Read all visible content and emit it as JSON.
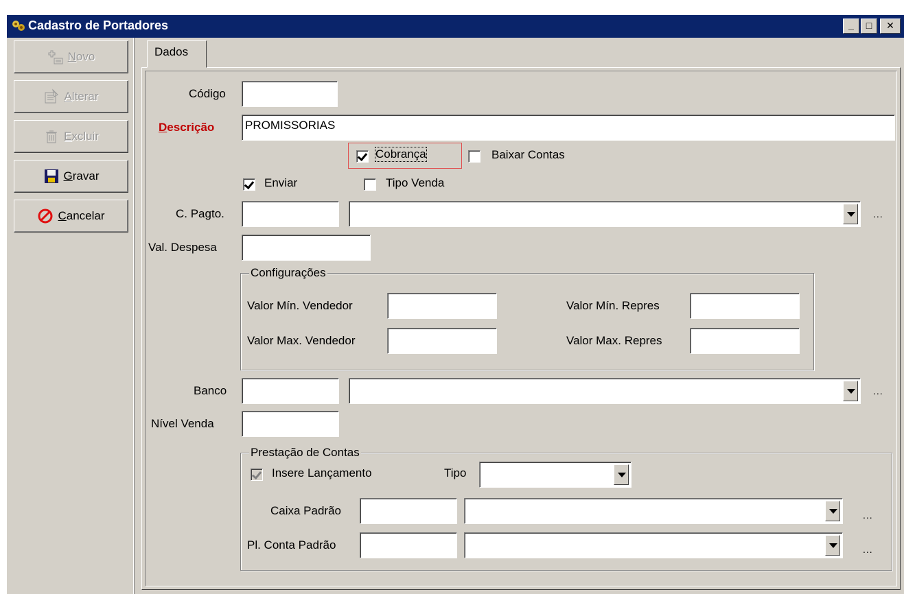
{
  "window": {
    "title": "Cadastro de Portadores",
    "controls": {
      "minimize": "_",
      "maximize": "□",
      "close": "✕"
    },
    "titlebar_color": "#0a246a"
  },
  "toolbar": {
    "novo": {
      "prefix": "",
      "hotkey": "N",
      "rest": "ovo",
      "enabled": false,
      "icon": "new-record-icon"
    },
    "alterar": {
      "prefix": "",
      "hotkey": "A",
      "rest": "lterar",
      "enabled": false,
      "icon": "edit-record-icon"
    },
    "excluir": {
      "prefix": "",
      "hotkey": "E",
      "rest": "xcluir",
      "enabled": false,
      "icon": "trash-icon"
    },
    "gravar": {
      "prefix": "",
      "hotkey": "G",
      "rest": "ravar",
      "enabled": true,
      "icon": "floppy-disk-icon"
    },
    "cancelar": {
      "prefix": "",
      "hotkey": "C",
      "rest": "ancelar",
      "enabled": true,
      "icon": "cancel-circle-icon"
    }
  },
  "tabs": [
    {
      "label": "Dados",
      "active": true
    }
  ],
  "form": {
    "codigo": {
      "label": "Código",
      "value": ""
    },
    "descricao": {
      "label_hotkey": "D",
      "label_rest": "escrição",
      "value": "PROMISSORIAS",
      "label_color": "#c00000"
    },
    "cobranca": {
      "label": "Cobrança",
      "checked": true
    },
    "baixar_contas": {
      "label": "Baixar Contas",
      "checked": false
    },
    "enviar": {
      "label": "Enviar",
      "checked": true
    },
    "tipo_venda": {
      "label": "Tipo Venda",
      "checked": false
    },
    "c_pagto": {
      "label": "C. Pagto.",
      "code": "",
      "selected": "",
      "lookup": "..."
    },
    "val_despesa": {
      "label": "Val. Despesa",
      "value": ""
    },
    "configuracoes": {
      "title": "Configurações",
      "valor_min_vendedor": {
        "label": "Valor Mín. Vendedor",
        "value": ""
      },
      "valor_max_vendedor": {
        "label": "Valor Max. Vendedor",
        "value": ""
      },
      "valor_min_repres": {
        "label": "Valor Mín. Repres",
        "value": ""
      },
      "valor_max_repres": {
        "label": "Valor Max. Repres",
        "value": ""
      }
    },
    "banco": {
      "label": "Banco",
      "code": "",
      "selected": "",
      "lookup": "..."
    },
    "nivel_venda": {
      "label": "Nível Venda",
      "value": ""
    },
    "prestacao": {
      "title": "Prestação de Contas",
      "insere_lancamento": {
        "label": "Insere Lançamento",
        "checked": true,
        "enabled": false
      },
      "tipo": {
        "label": "Tipo",
        "selected": ""
      },
      "caixa_padrao": {
        "label": "Caixa Padrão",
        "code": "",
        "selected": "",
        "lookup": "..."
      },
      "pl_conta_padrao": {
        "label": "Pl. Conta Padrão",
        "code": "",
        "selected": "",
        "lookup": "..."
      }
    }
  }
}
